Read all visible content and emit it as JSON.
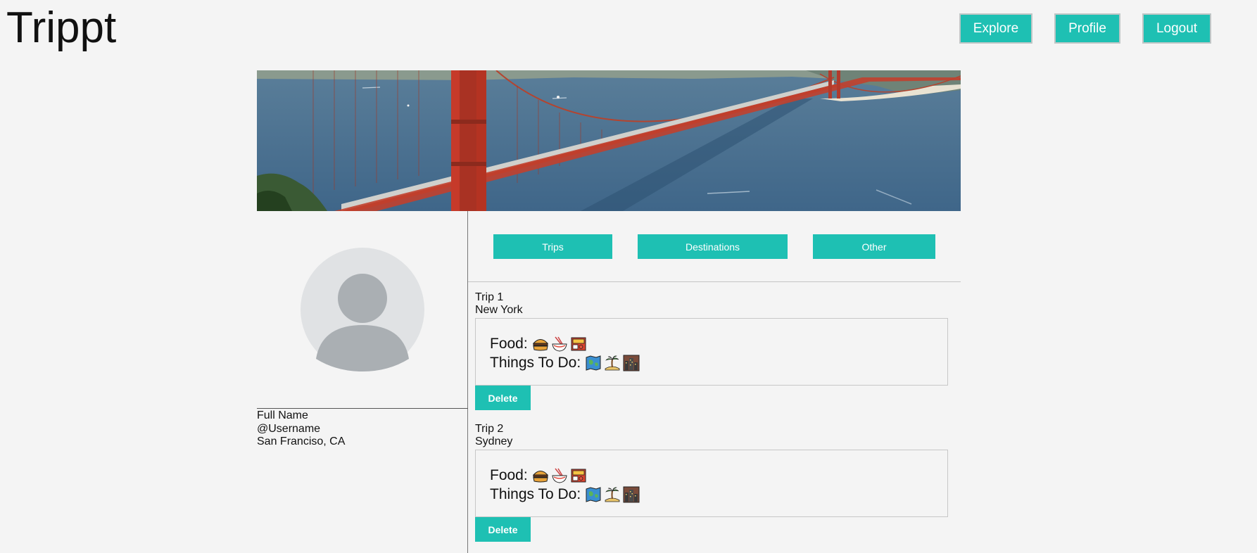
{
  "app": {
    "title": "Trippt"
  },
  "nav": {
    "explore": "Explore",
    "profile": "Profile",
    "logout": "Logout"
  },
  "profile": {
    "full_name": "Full Name",
    "username": "@Username",
    "location": "San Franciso, CA"
  },
  "tabs": [
    {
      "label": "Trips"
    },
    {
      "label": "Destinations"
    },
    {
      "label": "Other"
    }
  ],
  "trips": [
    {
      "title": "Trip 1",
      "city": "New York",
      "food_label": "Food:",
      "food_icons": [
        "burger-icon",
        "noodle-bowl-icon",
        "bento-box-icon"
      ],
      "todo_label": "Things To Do:",
      "todo_icons": [
        "map-icon",
        "palm-island-icon",
        "city-icon"
      ],
      "delete_label": "Delete"
    },
    {
      "title": "Trip 2",
      "city": "Sydney",
      "food_label": "Food:",
      "food_icons": [
        "burger-icon",
        "noodle-bowl-icon",
        "bento-box-icon"
      ],
      "todo_label": "Things To Do:",
      "todo_icons": [
        "map-icon",
        "palm-island-icon",
        "city-icon"
      ],
      "delete_label": "Delete"
    }
  ],
  "colors": {
    "accent": "#1ec0b3",
    "background": "#f4f4f4",
    "banner_water": "#4f7595",
    "bridge": "#c63a2a"
  }
}
